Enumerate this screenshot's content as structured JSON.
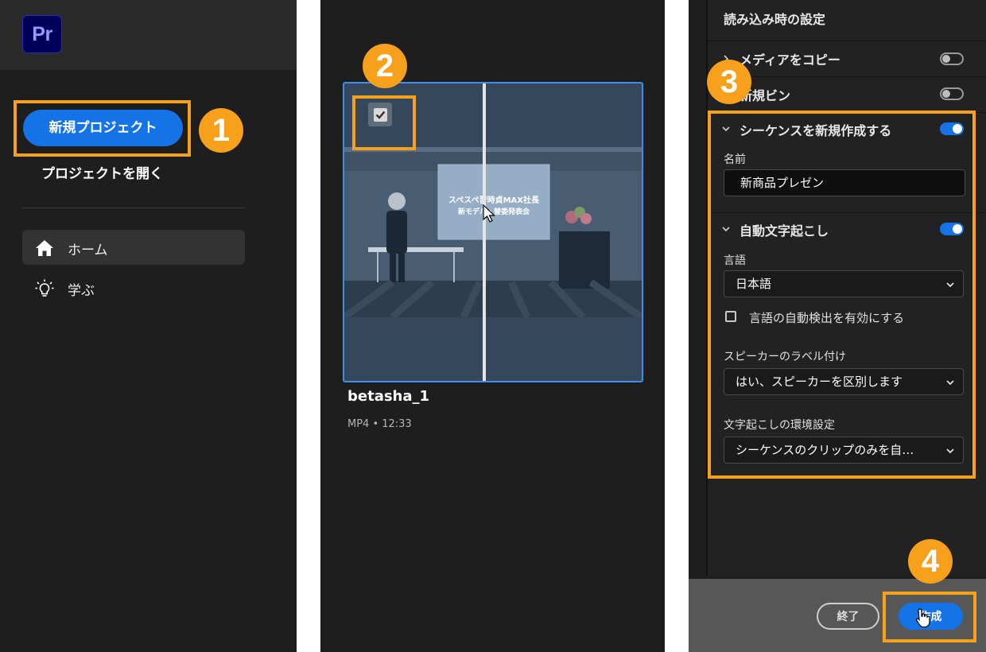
{
  "app": {
    "logo_text": "Pr",
    "brand_color": "#00005b",
    "accent_color": "#1473e6",
    "highlight_color": "#f7a01c"
  },
  "steps": [
    "1",
    "2",
    "3",
    "4"
  ],
  "home": {
    "new_project": "新規プロジェクト",
    "open_project": "プロジェクトを開く",
    "nav": [
      {
        "label": "ホーム",
        "icon": "home-icon",
        "active": true
      },
      {
        "label": "学ぶ",
        "icon": "lightbulb-icon",
        "active": false
      }
    ]
  },
  "media": {
    "thumbnail": {
      "selected": true,
      "slide_line1": "スペスペ習時貞MAX社長",
      "slide_line2": "新モデル・替委発表会"
    },
    "title": "betasha_1",
    "meta": "MP4 • 12:33"
  },
  "import_settings": {
    "heading": "読み込み時の設定",
    "copy_media": {
      "label": "メディアをコピー",
      "enabled": false
    },
    "new_bin": {
      "label": "新規ビン",
      "enabled": false
    },
    "new_sequence": {
      "label": "シーケンスを新規作成する",
      "enabled": true,
      "name_label": "名前",
      "name_value": "新商品プレゼン"
    },
    "auto_transcribe": {
      "label": "自動文字起こし",
      "enabled": true,
      "language_label": "言語",
      "language_value": "日本語",
      "auto_detect_label": "言語の自動検出を有効にする",
      "auto_detect_checked": false,
      "speaker_label": "スピーカーのラベル付け",
      "speaker_value": "はい、スピーカーを区別します",
      "prefs_label": "文字起こしの環境設定",
      "prefs_value": "シーケンスのクリップのみを自…"
    },
    "exit_button": "終了",
    "create_button": "作成"
  }
}
